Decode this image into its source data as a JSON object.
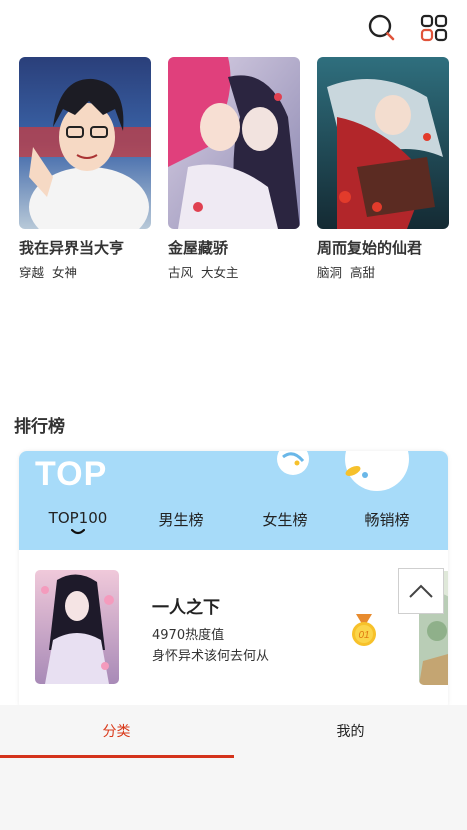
{
  "toolbar": {
    "search_icon": "search-icon",
    "grid_icon": "apps-grid-icon",
    "accent": "#e0533a"
  },
  "featured": [
    {
      "title": "我在异界当大亨",
      "tags": [
        "穿越",
        "女神"
      ]
    },
    {
      "title": "金屋藏骄",
      "tags": [
        "古风",
        "大女主"
      ]
    },
    {
      "title": "周而复始的仙君",
      "tags": [
        "脑洞",
        "高甜"
      ]
    }
  ],
  "ranking": {
    "section_title": "排行榜",
    "banner_text": "TOP",
    "header_color": "#a7dbf9",
    "tabs": [
      {
        "label": "TOP100",
        "active": true
      },
      {
        "label": "男生榜",
        "active": false
      },
      {
        "label": "女生榜",
        "active": false
      },
      {
        "label": "畅销榜",
        "active": false
      }
    ],
    "items": [
      {
        "rank": "01",
        "title": "一人之下",
        "heat": "4970热度值",
        "description": "身怀异术该何去何从"
      }
    ]
  },
  "scroll_top_icon": "chevron-up-icon",
  "bottom_nav": {
    "tabs": [
      {
        "label": "分类",
        "active": true
      },
      {
        "label": "我的",
        "active": false
      }
    ],
    "active_color": "#d93a1b"
  }
}
